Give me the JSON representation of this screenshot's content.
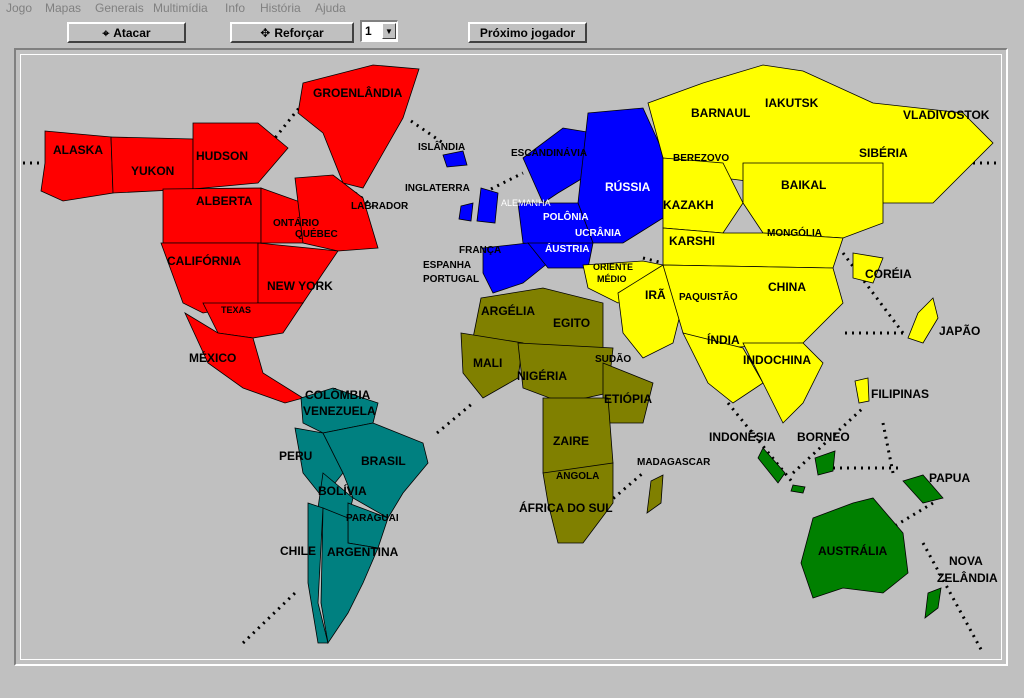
{
  "menu": [
    "Jogo",
    "Mapas",
    "Generais",
    "Multimídia",
    "Info",
    "História",
    "Ajuda"
  ],
  "toolbar": {
    "attack_label": "Atacar",
    "attack_icon": "crosshair-icon",
    "reinforce_label": "Reforçar",
    "reinforce_icon": "move-arrows-icon",
    "count_value": "1",
    "next_player_label": "Próximo jogador"
  },
  "colors": {
    "north_america": "#ff0000",
    "south_america": "#008080",
    "europe": "#0000ff",
    "africa": "#808000",
    "asia": "#ffff00",
    "oceania": "#008000",
    "ocean": "#c0c0c0"
  },
  "territories": {
    "alaska": "ALASKA",
    "yukon": "YUKON",
    "hudson": "HUDSON",
    "groenlandia": "GROENLÂNDIA",
    "alberta": "ALBERTA",
    "ontario": "ONTÁRIO",
    "quebec": "QUÉBEC",
    "labrador": "LABRADOR",
    "california": "CALIFÓRNIA",
    "new_york": "NEW YORK",
    "texas": "TEXAS",
    "mexico": "MÉXICO",
    "islandia": "ISLÂNDIA",
    "escandinavia": "ESCANDINÁVIA",
    "inglaterra": "INGLATERRA",
    "alemanha": "ALEMANHA",
    "polonia": "POLÔNIA",
    "ucrania": "UCRÂNIA",
    "russia": "RÚSSIA",
    "austria": "ÁUSTRIA",
    "franca": "FRANÇA",
    "espanha": "ESPANHA",
    "portugal": "PORTUGAL",
    "oriente_medio_1": "ORIENTE",
    "oriente_medio_2": "MÉDIO",
    "barnaul": "BARNAUL",
    "iakutsk": "IAKUTSK",
    "vladivostok": "VLADIVOSTOK",
    "berezovo": "BEREZOVO",
    "siberia": "SIBÉRIA",
    "baikal": "BAIKAL",
    "kazakh": "KAZAKH",
    "mongolia": "MONGÓLIA",
    "karshi": "KARSHI",
    "coreia": "CORÉIA",
    "china": "CHINA",
    "ira": "IRÃ",
    "paquistao": "PAQUISTÃO",
    "japao": "JAPÃO",
    "india": "ÍNDIA",
    "indochina": "INDOCHINA",
    "filipinas": "FILIPINAS",
    "argelia": "ARGÉLIA",
    "egito": "EGITO",
    "mali": "MALI",
    "sudao": "SUDÃO",
    "nigeria": "NIGÉRIA",
    "etiopia": "ETIÓPIA",
    "zaire": "ZAIRE",
    "angola": "ANGOLA",
    "madagascar": "MADAGASCAR",
    "africa_do_sul": "ÁFRICA DO SUL",
    "colombia": "COLÔMBIA",
    "venezuela": "VENEZUELA",
    "peru": "PERU",
    "brasil": "BRASIL",
    "bolivia": "BOLÍVIA",
    "paraguai": "PARAGUAI",
    "chile": "CHILE",
    "argentina": "ARGENTINA",
    "indonesia": "INDONÉSIA",
    "borneo": "BORNEO",
    "papua": "PAPUA",
    "australia": "AUSTRÁLIA",
    "nova_zelandia_1": "NOVA",
    "nova_zelandia_2": "ZELÂNDIA"
  }
}
